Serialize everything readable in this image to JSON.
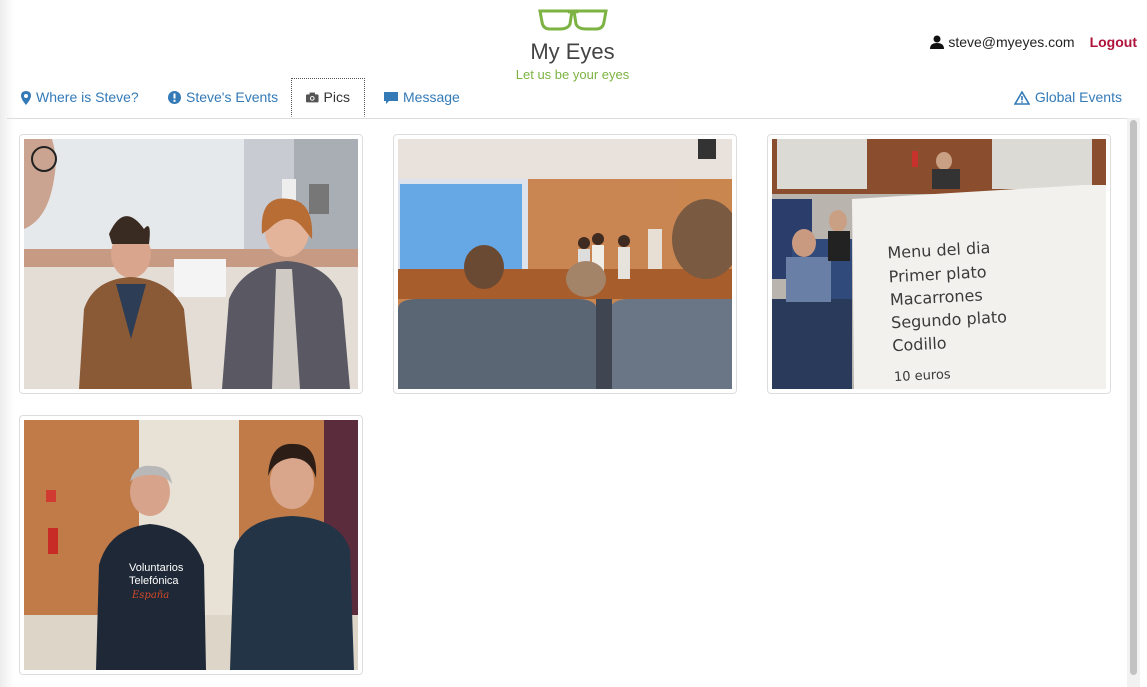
{
  "app": {
    "brand": "My Eyes",
    "tagline": "Let us be your eyes",
    "logo_icon": "glasses-icon",
    "accent_color": "#7cb342",
    "link_color": "#337ab7",
    "logout_color": "#b0123a"
  },
  "user": {
    "email": "steve@myeyes.com",
    "logout_label": "Logout"
  },
  "tabs": {
    "where": "Where is Steve?",
    "events": "Steve's Events",
    "pics": "Pics",
    "message": "Message",
    "global": "Global Events",
    "active": "Pics"
  },
  "pics": {
    "note": {
      "line1": "Menu del dia",
      "line2": "Primer plato",
      "line3": "Macarrones",
      "line4": "Segundo plato",
      "line5": "Codillo",
      "line6": "10 euros"
    },
    "sweater": {
      "line1": "Voluntarios",
      "line2": "Telefónica",
      "line3": "España"
    }
  }
}
